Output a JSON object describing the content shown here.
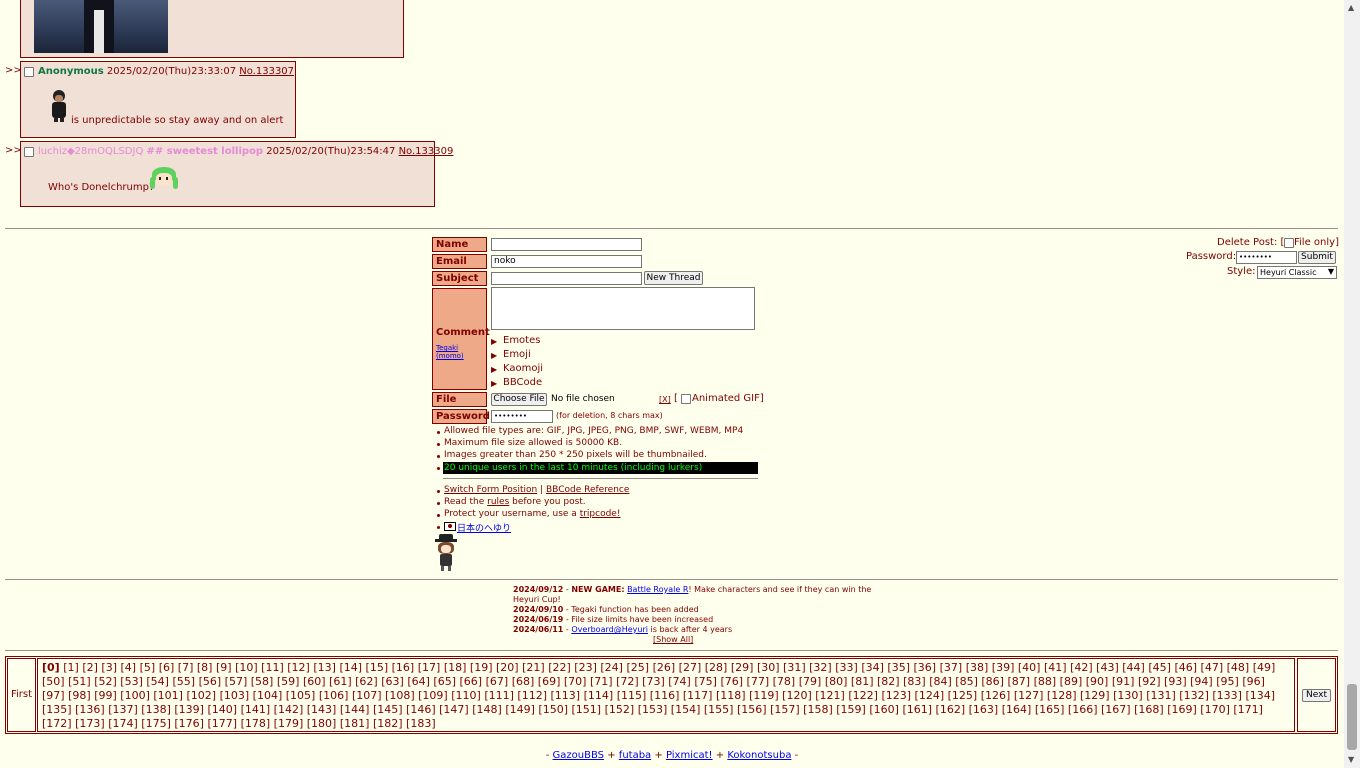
{
  "replies": [
    {
      "marker": ">>",
      "name": "Anonymous",
      "datetime": "2025/02/20(Thu)23:33:07",
      "post_no": "No.133307",
      "text": "is unpredictable so stay away and on alert"
    },
    {
      "marker": ">>",
      "name": "luchiz",
      "tripcode": "◆28mOQLSDJQ",
      "secure_trip": "## sweetest lollipop",
      "datetime": "2025/02/20(Thu)23:54:47",
      "post_no": "No.133309",
      "text": "Who's Donelchrump?"
    }
  ],
  "form": {
    "labels": {
      "name": "Name",
      "email": "Email",
      "subject": "Subject",
      "comment": "Comment",
      "tegaki": "Tegaki (momo)",
      "file": "File",
      "password": "Password"
    },
    "email_value": "noko",
    "new_thread_button": "New Thread",
    "menus": [
      "Emotes",
      "Emoji",
      "Kaomoji",
      "BBCode"
    ],
    "choose_file_button": "Choose File",
    "no_file": "No file chosen",
    "clear_file": "[X]",
    "animated_gif_open": "[",
    "animated_gif_label": "Animated GIF]",
    "password_value": "••••••••",
    "password_hint": "(for deletion, 8 chars max)"
  },
  "rules": [
    "Allowed file types are: GIF, JPG, JPEG, PNG, BMP, SWF, WEBM, MP4",
    "Maximum file size allowed is 50000 KB.",
    "Images greater than 250 * 250 pixels will be thumbnailed."
  ],
  "users_online": "20 unique users in the last 10 minutes (including lurkers)",
  "links": {
    "switch_form": "Switch Form Position",
    "sep": "|",
    "bbcode_ref": "BBCode Reference",
    "read_the": "Read the",
    "rules": "rules",
    "before_post": "before you post.",
    "protect": "Protect your username, use a",
    "tripcode": "tripcode!",
    "japanese": "日本のへゆり"
  },
  "delete": {
    "label": "Delete Post: [",
    "file_only": "File only]",
    "password_label": "Password:",
    "password_value": "••••••••",
    "submit": "Submit",
    "style_label": "Style:",
    "style_value": "Heyuri Classic"
  },
  "news": [
    {
      "date": "2024/09/12",
      "prefix": " - ",
      "bold": "NEW GAME:",
      "link": "Battle Royale R",
      "text": "! Make characters and see if they can win the"
    },
    {
      "date": "",
      "prefix": "",
      "bold": "",
      "link": "",
      "text": "Heyuri Cup!"
    },
    {
      "date": "2024/09/10",
      "prefix": " - ",
      "bold": "",
      "link": "",
      "text": "Tegaki function has been added"
    },
    {
      "date": "2024/06/19",
      "prefix": " - ",
      "bold": "",
      "link": "",
      "text": "File size limits have been increased"
    },
    {
      "date": "2024/06/11",
      "prefix": " - ",
      "bold": "",
      "link": "Overboard@Heyuri",
      "text": " is back after 4 years"
    }
  ],
  "show_all": "[Show All]",
  "pager": {
    "first": "First",
    "next": "Next",
    "current": 0,
    "last": 183
  },
  "footer": {
    "dash_left": "-",
    "links": [
      "GazouBBS",
      "futaba",
      "Pixmicat!",
      "Kokonotsuba"
    ],
    "plus": "+",
    "dash_right": "-"
  }
}
